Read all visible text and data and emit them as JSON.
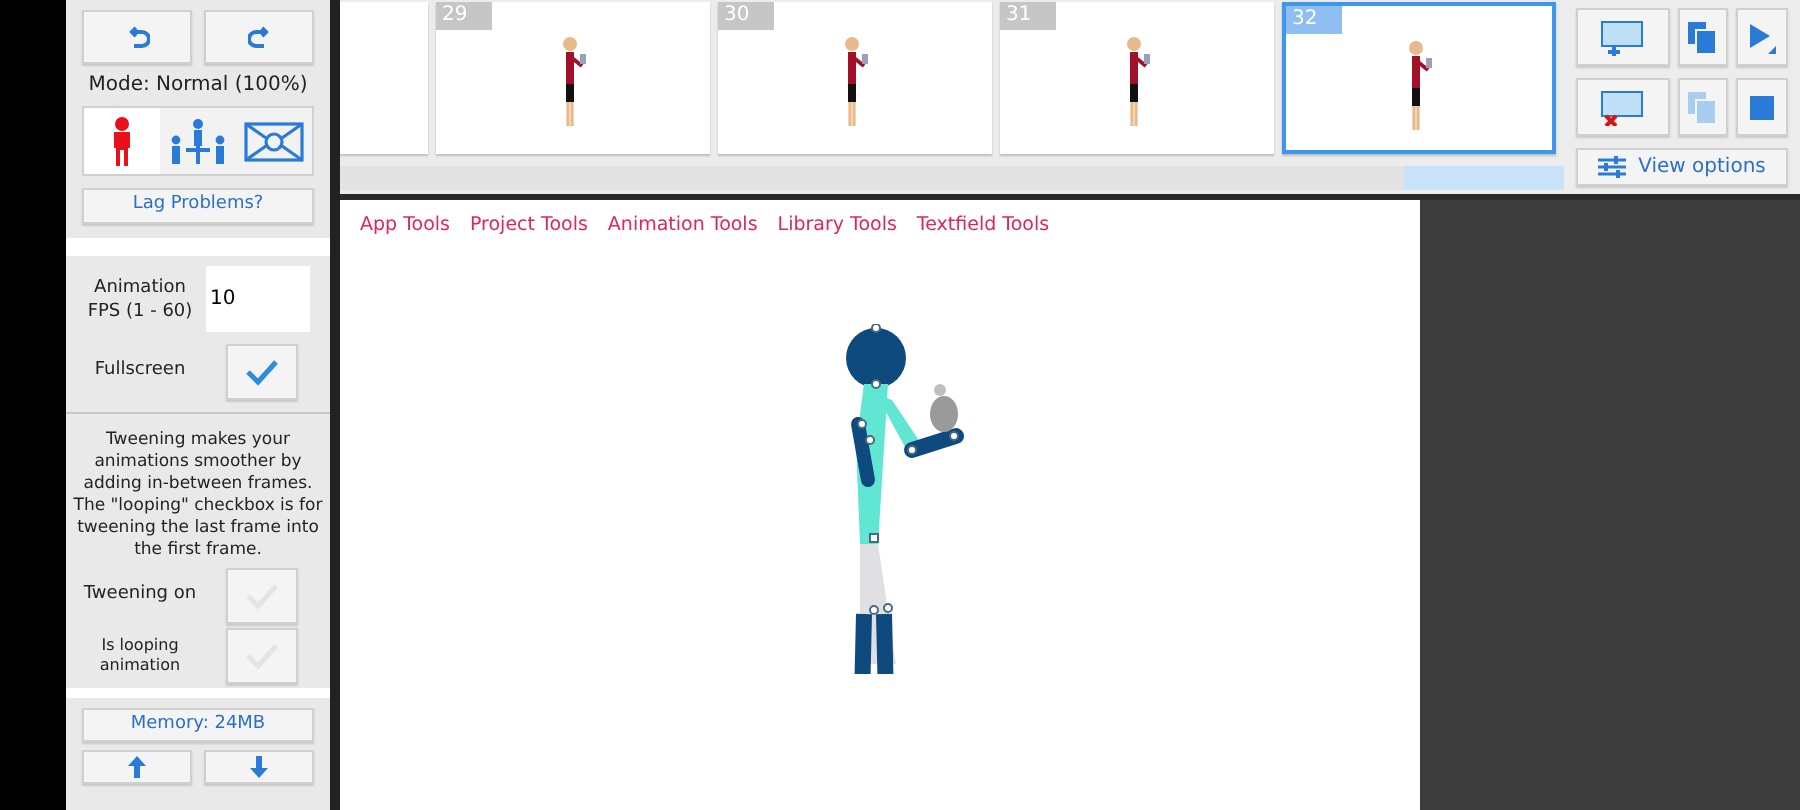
{
  "mode_label": "Mode: Normal (100%)",
  "mode_tabs": [
    {
      "kind": "single",
      "selected": true
    },
    {
      "kind": "group",
      "selected": false
    },
    {
      "kind": "scene",
      "selected": false
    }
  ],
  "lag_button": "Lag Problems?",
  "settings": {
    "fps_label": "Animation FPS (1 - 60)",
    "fps_value": "10",
    "fullscreen_label": "Fullscreen",
    "fullscreen_checked": true,
    "tweening_help": "Tweening makes your animations smoother by adding in-between frames. The \"looping\" checkbox is for tweening the last frame into the first frame.",
    "tweening_label": "Tweening on",
    "tweening_checked": false,
    "looping_label": "Is looping animation",
    "looping_checked": false
  },
  "memory_button": "Memory: 24MB",
  "frames": [
    {
      "number": "29",
      "selected": false
    },
    {
      "number": "30",
      "selected": false
    },
    {
      "number": "31",
      "selected": false
    },
    {
      "number": "32",
      "selected": true
    }
  ],
  "view_options_button": "View options",
  "menu": [
    "App Tools",
    "Project Tools",
    "Animation Tools",
    "Library Tools",
    "Textfield Tools"
  ]
}
